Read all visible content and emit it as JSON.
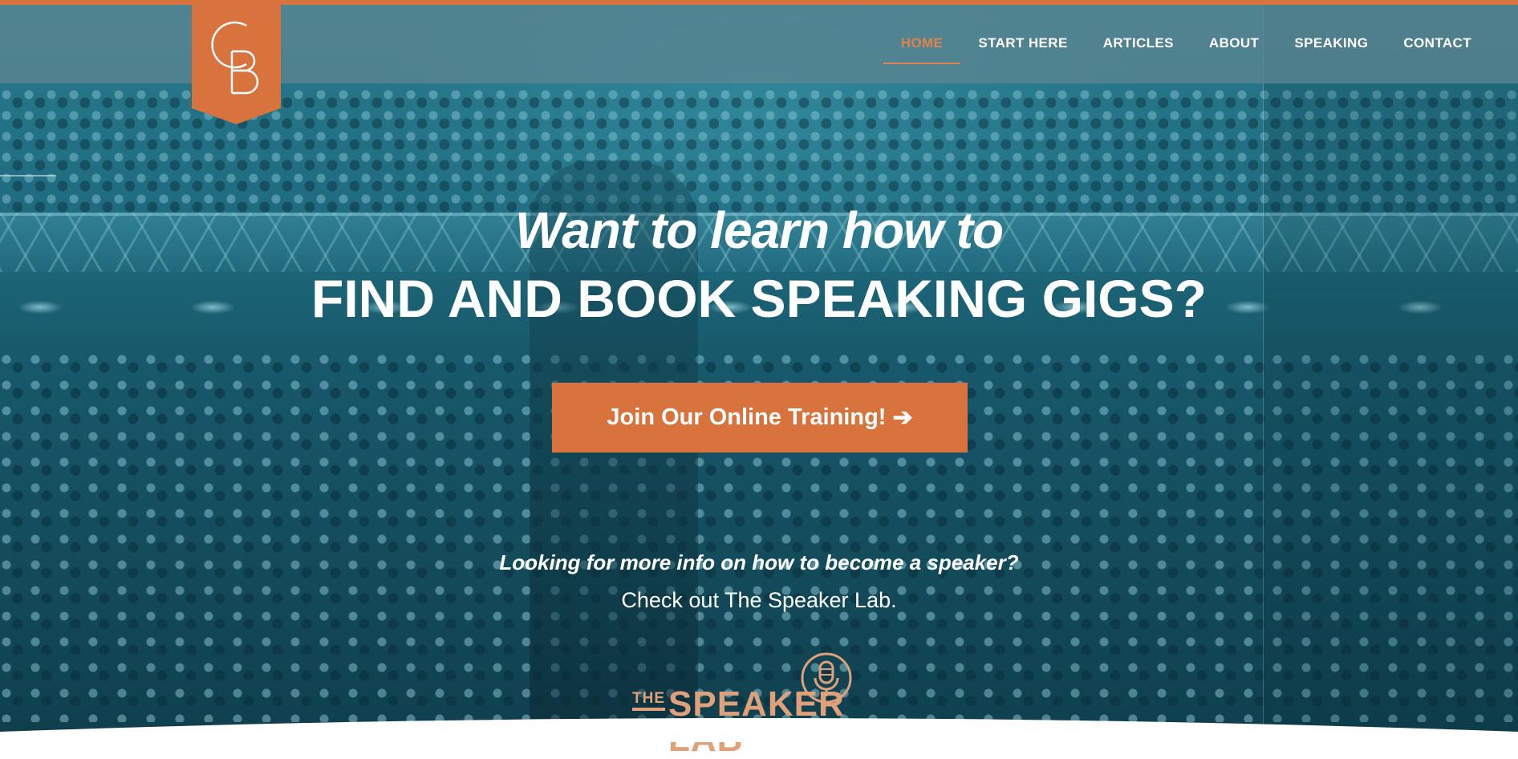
{
  "logo": {
    "initials": "GB",
    "bg_color": "#d8733d"
  },
  "nav": {
    "items": [
      {
        "label": "HOME",
        "active": true
      },
      {
        "label": "START HERE",
        "active": false
      },
      {
        "label": "ARTICLES",
        "active": false
      },
      {
        "label": "ABOUT",
        "active": false
      },
      {
        "label": "SPEAKING",
        "active": false
      },
      {
        "label": "CONTACT",
        "active": false
      }
    ],
    "active_color": "#e0824c"
  },
  "hero": {
    "headline_line1": "Want to learn how to",
    "headline_line2": "FIND AND BOOK SPEAKING GIGS?",
    "cta_label": "Join Our Online Training!",
    "cta_icon": "arrow-right-icon",
    "cta_color": "#d8733d",
    "sub_line1": "Looking for more info on how to become a speaker?",
    "sub_line2": "Check out The Speaker Lab.",
    "overlay_color": "#1f6c80"
  },
  "speaker_lab_logo": {
    "the": "THE",
    "name": "SPEAKER LAB",
    "icon": "microphone-icon",
    "color": "#e0a07a"
  }
}
